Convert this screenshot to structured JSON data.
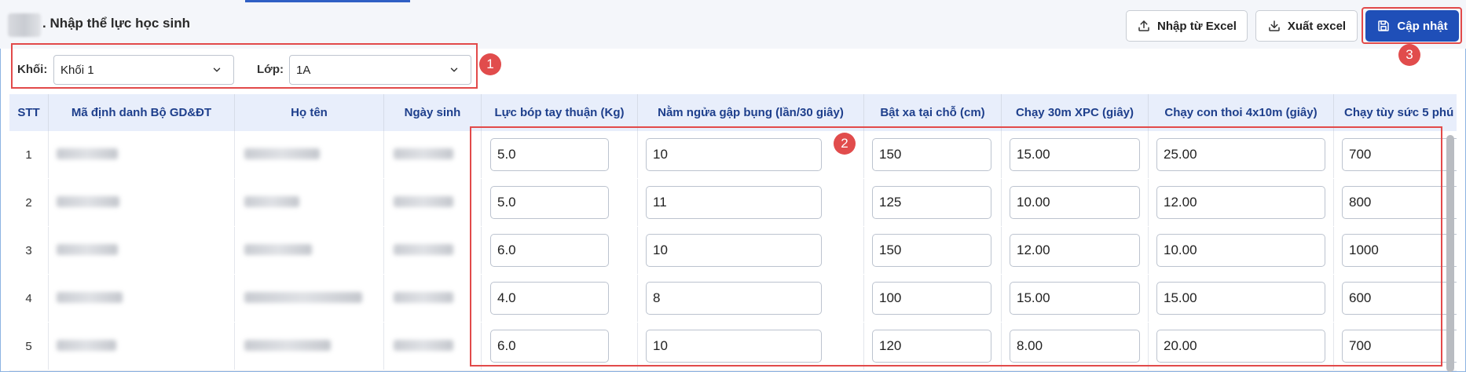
{
  "page": {
    "title": ". Nhập thể lực học sinh"
  },
  "toolbar": {
    "import_label": "Nhập từ Excel",
    "export_label": "Xuất excel",
    "save_label": "Cập nhật",
    "import_icon": "upload-icon",
    "export_icon": "download-icon",
    "save_icon": "save-icon"
  },
  "filters": {
    "grade_label": "Khối:",
    "grade_value": "Khối 1",
    "class_label": "Lớp:",
    "class_value": "1A"
  },
  "badges": [
    "1",
    "2",
    "3"
  ],
  "table": {
    "columns": [
      "STT",
      "Mã định danh Bộ GD&ĐT",
      "Họ tên",
      "Ngày sinh",
      "Lực bóp tay thuận (Kg)",
      "Nằm ngửa gập bụng (lần/30 giây)",
      "Bật xa tại chỗ (cm)",
      "Chạy 30m XPC (giây)",
      "Chạy con thoi 4x10m (giây)",
      "Chạy tùy sức 5 phú"
    ],
    "rows": [
      {
        "stt": "1",
        "values": [
          "5.0",
          "10",
          "150",
          "15.00",
          "25.00",
          "700"
        ]
      },
      {
        "stt": "2",
        "values": [
          "5.0",
          "11",
          "125",
          "10.00",
          "12.00",
          "800"
        ]
      },
      {
        "stt": "3",
        "values": [
          "6.0",
          "10",
          "150",
          "12.00",
          "10.00",
          "1000"
        ]
      },
      {
        "stt": "4",
        "values": [
          "4.0",
          "8",
          "100",
          "15.00",
          "15.00",
          "600"
        ]
      },
      {
        "stt": "5",
        "values": [
          "6.0",
          "10",
          "120",
          "8.00",
          "20.00",
          "700"
        ]
      }
    ]
  },
  "colors": {
    "accent": "#1f4fb8",
    "highlight": "#e24a4a",
    "header_bg": "#e8eefb",
    "header_text": "#1e3f8c"
  }
}
